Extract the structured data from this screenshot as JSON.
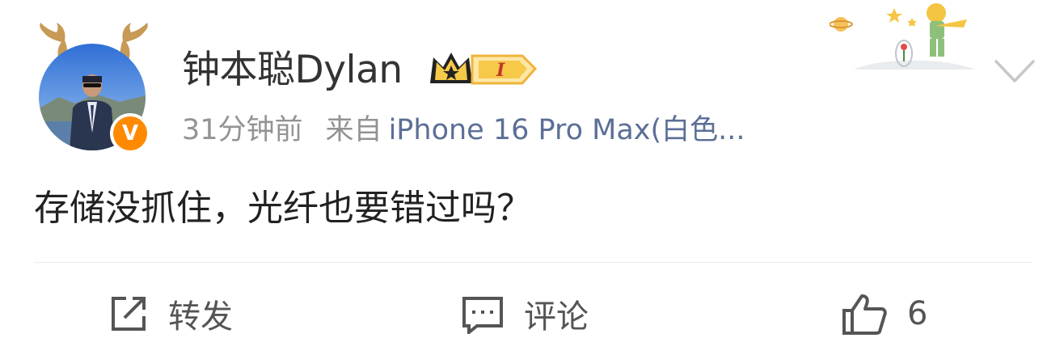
{
  "post": {
    "username": "钟本聪Dylan",
    "vip_level": "I",
    "time": "31分钟前",
    "from_label": "来自",
    "source": "iPhone 16 Pro Max(白色...",
    "text": "存储没抓住，光纤也要错过吗？"
  },
  "actions": {
    "repost_label": "转发",
    "comment_label": "评论",
    "like_count": "6"
  },
  "colors": {
    "badge_orange": "#ff8a00",
    "source_blue": "#5b6f96",
    "meta_gray": "#939393",
    "vip_gold": "#f7c948"
  },
  "icons": [
    "antler-icon",
    "verified-v-icon",
    "crown-icon",
    "chevron-down-icon",
    "repost-icon",
    "comment-icon",
    "like-icon"
  ]
}
